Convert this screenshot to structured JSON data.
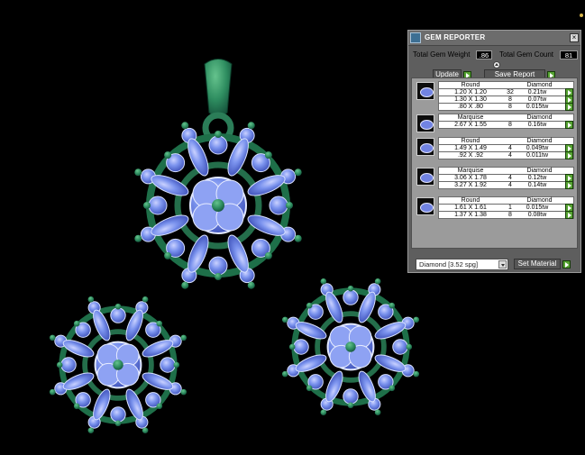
{
  "window": {
    "title": "GEM REPORTER"
  },
  "summary": {
    "weight_label": "Total Gem Weight",
    "weight_value": ".86",
    "count_label": "Total Gem Count",
    "count_value": "81"
  },
  "actions": {
    "update": "Update",
    "save_report": "Save Report",
    "set_material": "Set Material"
  },
  "report": {
    "groups": [
      {
        "header": {
          "shape": "Round",
          "material": "Diamond"
        },
        "rows": [
          {
            "size": "1.20 X 1.20",
            "count": "32",
            "weight": "0.21tw"
          },
          {
            "size": "1.30 X 1.30",
            "count": "8",
            "weight": "0.07tw"
          },
          {
            "size": ".80 X .80",
            "count": "8",
            "weight": "0.015tw"
          }
        ]
      },
      {
        "header": {
          "shape": "Marquise",
          "material": "Diamond"
        },
        "rows": [
          {
            "size": "2.67 X 1.55",
            "count": "8",
            "weight": "0.16tw"
          }
        ]
      },
      {
        "header": {
          "shape": "Round",
          "material": "Diamond"
        },
        "rows": [
          {
            "size": "1.49 X 1.49",
            "count": "4",
            "weight": "0.049tw"
          },
          {
            "size": ".92 X .92",
            "count": "4",
            "weight": "0.011tw"
          }
        ]
      },
      {
        "header": {
          "shape": "Marquise",
          "material": "Diamond"
        },
        "rows": [
          {
            "size": "3.06 X 1.78",
            "count": "4",
            "weight": "0.12tw"
          },
          {
            "size": "3.27 X 1.92",
            "count": "4",
            "weight": "0.14tw"
          }
        ]
      },
      {
        "header": {
          "shape": "Round",
          "material": "Diamond"
        },
        "rows": [
          {
            "size": "1.61 X 1.61",
            "count": "1",
            "weight": "0.015tw"
          },
          {
            "size": "1.37 X 1.38",
            "count": "8",
            "weight": "0.08tw"
          }
        ]
      }
    ]
  },
  "material": {
    "selected": "Diamond   [3.52 spg]"
  },
  "colors": {
    "metal": "#2f8f63",
    "gem": "#7088e8",
    "panel": "#5e5e5e",
    "button_green": "#56a332"
  },
  "icons": {
    "app": "gem-reporter-icon",
    "close": "close-icon",
    "play": "play-icon",
    "scroll": "scroll-up-icon",
    "gem": "gem-thumbnail-icon"
  }
}
